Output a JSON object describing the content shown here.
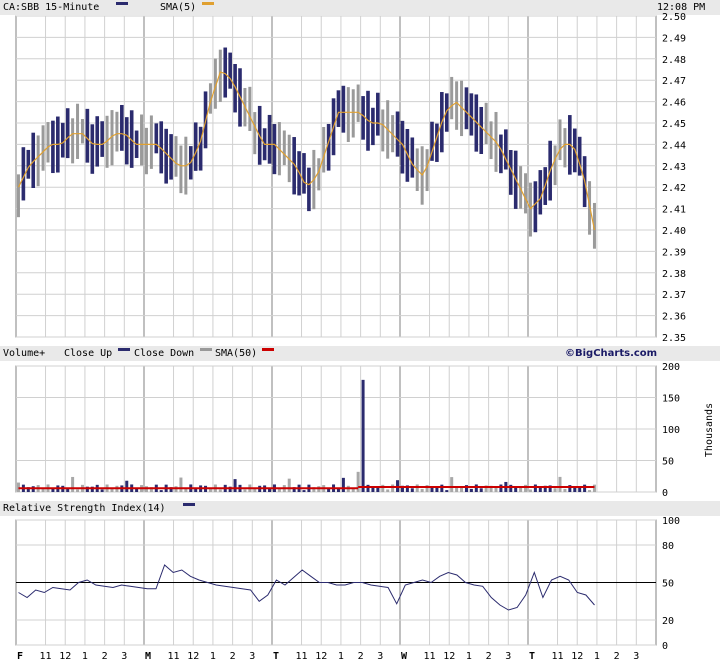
{
  "chart_data": [
    {
      "type": "line",
      "title": "CA:SBB 15-Minute",
      "time": "12:08 PM",
      "legend": [
        {
          "name": "CA:SBB 15-Minute",
          "color": "#2b2b6e"
        },
        {
          "name": "SMA(5)",
          "color": "#e0a030"
        }
      ],
      "ylim": [
        2.35,
        2.5
      ],
      "yticks": [
        "2.50",
        "2.49",
        "2.48",
        "2.47",
        "2.46",
        "2.45",
        "2.44",
        "2.43",
        "2.42",
        "2.41",
        "2.40",
        "2.39",
        "2.38",
        "2.37",
        "2.36",
        "2.35"
      ],
      "sma5_series": [
        2.42,
        2.43,
        2.435,
        2.44,
        2.44,
        2.445,
        2.445,
        2.44,
        2.44,
        2.445,
        2.445,
        2.44,
        2.44,
        2.44,
        2.435,
        2.43,
        2.43,
        2.44,
        2.46,
        2.475,
        2.47,
        2.46,
        2.45,
        2.44,
        2.44,
        2.435,
        2.43,
        2.42,
        2.425,
        2.44,
        2.455,
        2.455,
        2.455,
        2.45,
        2.45,
        2.445,
        2.44,
        2.43,
        2.425,
        2.44,
        2.455,
        2.46,
        2.455,
        2.45,
        2.445,
        2.44,
        2.43,
        2.42,
        2.41,
        2.415,
        2.43,
        2.44,
        2.44,
        2.425,
        2.4
      ],
      "grid": true
    },
    {
      "type": "bar",
      "title": "Volume+",
      "legend": [
        {
          "name": "Close Up",
          "color": "#2b2b6e"
        },
        {
          "name": "Close Down",
          "color": "#999999"
        },
        {
          "name": "SMA(50)",
          "color": "#cc0000"
        }
      ],
      "brand": "©BigCharts.com",
      "ylabel": "Thousands",
      "ylim": [
        0,
        200
      ],
      "yticks": [
        "200",
        "150",
        "100",
        "50",
        "0"
      ],
      "peak_value": 178,
      "sma50_value": 8,
      "grid": true
    },
    {
      "type": "line",
      "title": "Relative Strength Index(14)",
      "legend": [
        {
          "name": "Relative Strength Index(14)",
          "color": "#2b2b6e"
        }
      ],
      "ylim": [
        0,
        100
      ],
      "yticks": [
        "100",
        "80",
        "50",
        "20",
        "0"
      ],
      "reference_line": 50,
      "series": [
        42,
        38,
        44,
        42,
        46,
        45,
        44,
        50,
        52,
        48,
        47,
        46,
        48,
        47,
        46,
        45,
        45,
        64,
        58,
        60,
        55,
        52,
        50,
        48,
        47,
        46,
        45,
        44,
        35,
        40,
        52,
        48,
        54,
        60,
        55,
        50,
        50,
        48,
        48,
        50,
        50,
        48,
        47,
        46,
        33,
        48,
        50,
        52,
        50,
        55,
        58,
        56,
        50,
        48,
        47,
        38,
        32,
        28,
        30,
        40,
        58,
        38,
        52,
        55,
        52,
        42,
        40,
        32
      ],
      "grid": true
    }
  ],
  "x_axis": {
    "labels": [
      "F",
      "11",
      "12",
      "1",
      "2",
      "3",
      "M",
      "11",
      "12",
      "1",
      "2",
      "3",
      "T",
      "11",
      "12",
      "1",
      "2",
      "3",
      "W",
      "11",
      "12",
      "1",
      "2",
      "3",
      "T",
      "11",
      "12",
      "1",
      "2",
      "3"
    ],
    "bold": [
      "F",
      "M",
      "T",
      "W",
      "T"
    ]
  }
}
